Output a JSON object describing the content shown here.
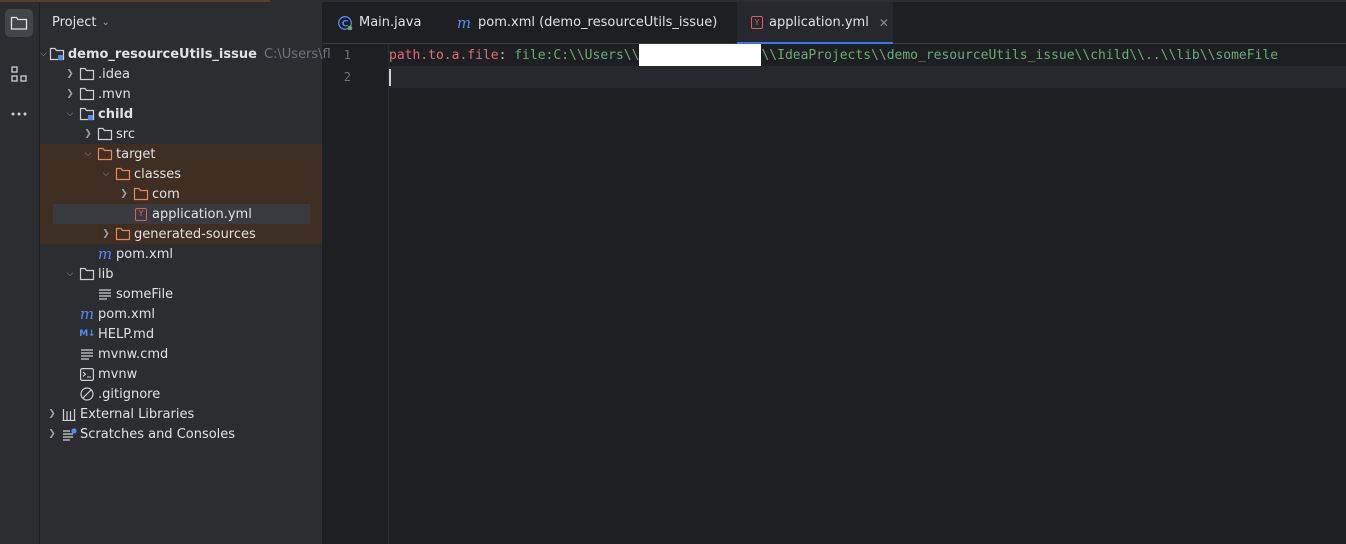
{
  "panel": {
    "title": "Project"
  },
  "tree": [
    {
      "label": "demo_resourceUtils_issue",
      "hint": "C:\\Users\\fl",
      "icon": "module-folder-icon"
    },
    {
      "label": ".idea",
      "icon": "folder-icon"
    },
    {
      "label": ".mvn",
      "icon": "folder-icon"
    },
    {
      "label": "child",
      "icon": "module-folder-icon"
    },
    {
      "label": "src",
      "icon": "folder-icon"
    },
    {
      "label": "target",
      "icon": "excluded-folder-icon"
    },
    {
      "label": "classes",
      "icon": "excluded-folder-icon"
    },
    {
      "label": "com",
      "icon": "excluded-folder-icon"
    },
    {
      "label": "application.yml",
      "icon": "yaml-file-icon"
    },
    {
      "label": "generated-sources",
      "icon": "excluded-folder-icon"
    },
    {
      "label": "pom.xml",
      "icon": "maven-file-icon"
    },
    {
      "label": "lib",
      "icon": "folder-icon"
    },
    {
      "label": "someFile",
      "icon": "text-file-icon"
    },
    {
      "label": "pom.xml",
      "icon": "maven-file-icon"
    },
    {
      "label": "HELP.md",
      "icon": "markdown-file-icon"
    },
    {
      "label": "mvnw.cmd",
      "icon": "text-file-icon"
    },
    {
      "label": "mvnw",
      "icon": "terminal-file-icon"
    },
    {
      "label": ".gitignore",
      "icon": "ignore-file-icon"
    },
    {
      "label": "External Libraries",
      "icon": "library-icon"
    },
    {
      "label": "Scratches and Consoles",
      "icon": "scratches-icon"
    }
  ],
  "tabs": [
    {
      "label": "Main.java",
      "icon": "java-class-icon"
    },
    {
      "label": "pom.xml (demo_resourceUtils_issue)",
      "icon": "maven-file-icon"
    },
    {
      "label": "application.yml",
      "icon": "yaml-file-icon",
      "active": true
    }
  ],
  "editor": {
    "line_numbers": [
      "1",
      "2"
    ],
    "line1": {
      "key": "path.to.a.file",
      "colon": ":",
      "value_prefix": " file:C:\\\\Users\\\\",
      "value_suffix": "\\\\IdeaProjects\\\\demo_resourceUtils_issue\\\\child\\\\..\\\\lib\\\\someFile"
    }
  },
  "colors": {
    "accent": "#3574f0",
    "excluded_row": "#3f2e22",
    "yaml_key": "#e06c75",
    "yaml_value": "#6aab73"
  }
}
